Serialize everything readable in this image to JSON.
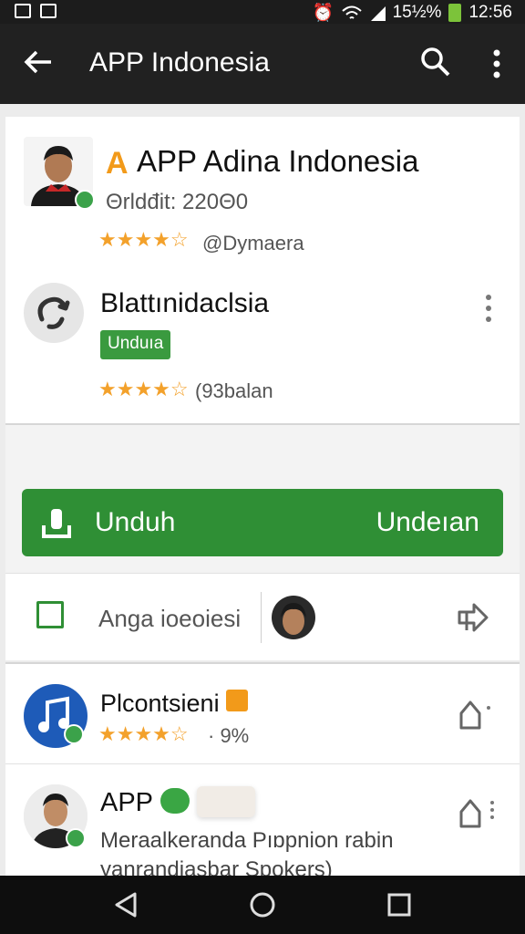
{
  "status_bar": {
    "battery_text": "15½%",
    "time": "12:56"
  },
  "app_bar": {
    "title": "APP Indonesia",
    "back_icon": "arrow-back-icon",
    "search_icon": "search-icon",
    "more_icon": "more-vert-icon"
  },
  "featured": {
    "logo_letter": "A",
    "title": "APP Adina Indonesia",
    "subtitle": "Θrldđit: 220Θ0",
    "stars": "★★★★☆",
    "rating_text": "@Dymaera"
  },
  "second_app": {
    "title": "Blattınidaclsia",
    "badge": "Unduıa",
    "stars": "★★★★☆",
    "rating_text": "(93balan"
  },
  "actions": {
    "download_label_left": "Unduh",
    "download_label_right": "Undeıan",
    "option_label": "Anga ioeoiesi"
  },
  "list_items": [
    {
      "title": "Plcontsieni",
      "stars": "★★★★☆",
      "meta": "· 9%"
    },
    {
      "title": "APP",
      "description": "Meraalkeranda Pıɒpnion rabin yanrandiasbar Spokers)"
    }
  ],
  "colors": {
    "accent_green": "#2f8f35",
    "star_orange": "#f3a12b",
    "music_blue": "#1e5bb8"
  }
}
